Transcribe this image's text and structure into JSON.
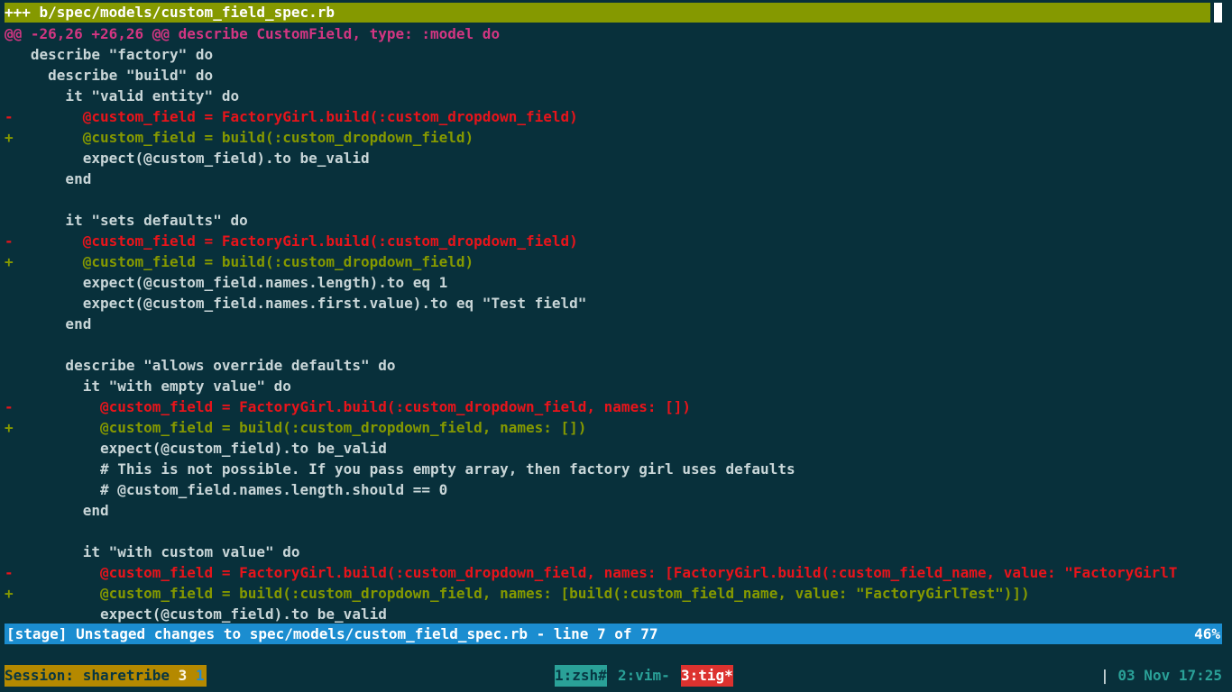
{
  "diff": {
    "file_header": "+++ b/spec/models/custom_field_spec.rb",
    "lines": [
      {
        "type": "hunk",
        "text": "@@ -26,26 +26,26 @@ describe CustomField, type: :model do"
      },
      {
        "type": "ctx",
        "text": "   describe \"factory\" do"
      },
      {
        "type": "ctx",
        "text": "     describe \"build\" do"
      },
      {
        "type": "ctx",
        "text": "       it \"valid entity\" do"
      },
      {
        "type": "del",
        "text": "-        @custom_field = FactoryGirl.build(:custom_dropdown_field)"
      },
      {
        "type": "add",
        "text": "+        @custom_field = build(:custom_dropdown_field)"
      },
      {
        "type": "ctx",
        "text": "         expect(@custom_field).to be_valid"
      },
      {
        "type": "ctx",
        "text": "       end"
      },
      {
        "type": "ctx",
        "text": ""
      },
      {
        "type": "ctx",
        "text": "       it \"sets defaults\" do"
      },
      {
        "type": "del",
        "text": "-        @custom_field = FactoryGirl.build(:custom_dropdown_field)"
      },
      {
        "type": "add",
        "text": "+        @custom_field = build(:custom_dropdown_field)"
      },
      {
        "type": "ctx",
        "text": "         expect(@custom_field.names.length).to eq 1"
      },
      {
        "type": "ctx",
        "text": "         expect(@custom_field.names.first.value).to eq \"Test field\""
      },
      {
        "type": "ctx",
        "text": "       end"
      },
      {
        "type": "ctx",
        "text": ""
      },
      {
        "type": "ctx",
        "text": "       describe \"allows override defaults\" do"
      },
      {
        "type": "ctx",
        "text": "         it \"with empty value\" do"
      },
      {
        "type": "del",
        "text": "-          @custom_field = FactoryGirl.build(:custom_dropdown_field, names: [])"
      },
      {
        "type": "add",
        "text": "+          @custom_field = build(:custom_dropdown_field, names: [])"
      },
      {
        "type": "ctx",
        "text": "           expect(@custom_field).to be_valid"
      },
      {
        "type": "ctx",
        "text": "           # This is not possible. If you pass empty array, then factory girl uses defaults"
      },
      {
        "type": "ctx",
        "text": "           # @custom_field.names.length.should == 0"
      },
      {
        "type": "ctx",
        "text": "         end"
      },
      {
        "type": "ctx",
        "text": ""
      },
      {
        "type": "ctx",
        "text": "         it \"with custom value\" do"
      },
      {
        "type": "del",
        "text": "-          @custom_field = FactoryGirl.build(:custom_dropdown_field, names: [FactoryGirl.build(:custom_field_name, value: \"FactoryGirlT"
      },
      {
        "type": "add",
        "text": "+          @custom_field = build(:custom_dropdown_field, names: [build(:custom_field_name, value: \"FactoryGirlTest\")])"
      },
      {
        "type": "ctx",
        "text": "           expect(@custom_field).to be_valid"
      }
    ]
  },
  "status_bar": {
    "text": "[stage] Unstaged changes to spec/models/custom_field_spec.rb - line 7 of 77",
    "percent": "46%"
  },
  "tmux": {
    "session_label": "Session: sharetribe ",
    "session_num1": "3",
    "session_num2": "1",
    "windows": [
      {
        "label": "1:zsh#"
      },
      {
        "label": "2:vim-"
      },
      {
        "label": "3:tig*"
      }
    ],
    "separator": "|",
    "datetime": "03 Nov 17:25"
  },
  "colors": {
    "background": "#08303b",
    "header": "#859900",
    "hunk": "#d33682",
    "deleted": "#e8141b",
    "added": "#859900",
    "status": "#1b8dd0"
  }
}
